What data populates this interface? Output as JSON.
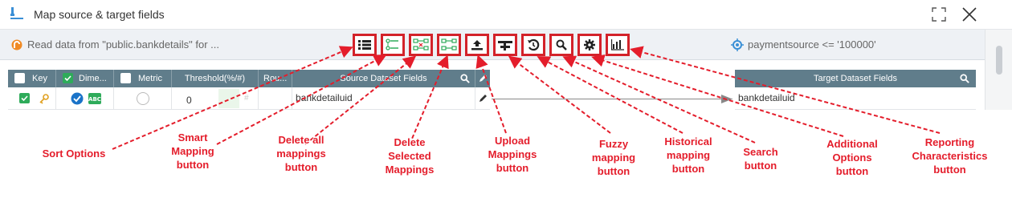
{
  "window": {
    "title": "Map source & target fields",
    "expand_icon": "expand-icon",
    "close_icon": "close-icon"
  },
  "info_bar": {
    "source_text": "Read data from \"public.bankdetails\" for ...",
    "filter_text": "paymentsource <= '100000'"
  },
  "toolbar": [
    {
      "name": "sort-options-button",
      "icon": "list-icon"
    },
    {
      "name": "smart-mapping-button",
      "icon": "smart-map-icon"
    },
    {
      "name": "delete-all-mappings-button",
      "icon": "delete-all-map-icon"
    },
    {
      "name": "delete-selected-mappings-button",
      "icon": "delete-selected-map-icon"
    },
    {
      "name": "upload-mappings-button",
      "icon": "upload-icon"
    },
    {
      "name": "fuzzy-mapping-button",
      "icon": "fuzzy-icon"
    },
    {
      "name": "historical-mapping-button",
      "icon": "history-icon"
    },
    {
      "name": "search-button",
      "icon": "search-icon"
    },
    {
      "name": "additional-options-button",
      "icon": "gear-icon"
    },
    {
      "name": "reporting-characteristics-button",
      "icon": "bar-chart-icon"
    }
  ],
  "source_grid": {
    "headers": {
      "key": "Key",
      "dimension": "Dime...",
      "metric": "Metric",
      "threshold": "Threshold(%/#)",
      "round": "Rou...",
      "fields": "Source Dataset Fields"
    },
    "row": {
      "threshold": "0",
      "field": "bankdetailuid"
    }
  },
  "target_grid": {
    "header": "Target Dataset Fields",
    "row": {
      "field": "bankdetailuid"
    }
  },
  "annotations": {
    "sort_options": "Sort Options",
    "smart_mapping": "Smart\nMapping\nbutton",
    "delete_all": "Delete all\nmappings\nbutton",
    "delete_selected": "Delete\nSelected\nMappings",
    "upload": "Upload\nMappings\nbutton",
    "fuzzy": "Fuzzy\nmapping\nbutton",
    "historical": "Historical\nmapping\nbutton",
    "search": "Search\nbutton",
    "additional": "Additional\nOptions\nbutton",
    "reporting": "Reporting\nCharacteristics\nbutton"
  },
  "colors": {
    "annotation_red": "#e41d2b",
    "grid_header": "#607d8b",
    "checkbox_green": "#2eab5a",
    "radio_blue": "#1a73c8"
  }
}
